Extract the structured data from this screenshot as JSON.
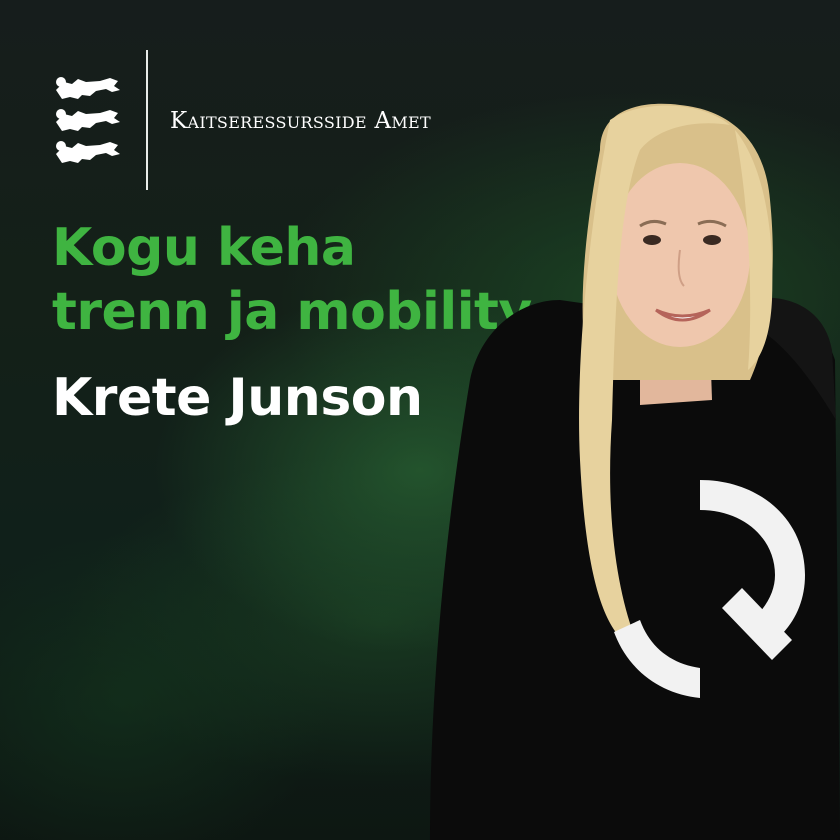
{
  "header": {
    "logo": {
      "icon": "three-lions-coat-of-arms-icon",
      "color": "#ffffff"
    },
    "agency_name": "Kaitseressursside Amet"
  },
  "main": {
    "title_lines": [
      "Kogu keha",
      "trenn ja mobility"
    ],
    "speaker_name": "Krete Junson"
  },
  "colors": {
    "title_green": "#3fb441",
    "background_dark": "#0d1410",
    "text_white": "#ffffff"
  },
  "photo": {
    "subject": "speaker-portrait",
    "hoodie_logo": "white-q-logo-icon"
  }
}
